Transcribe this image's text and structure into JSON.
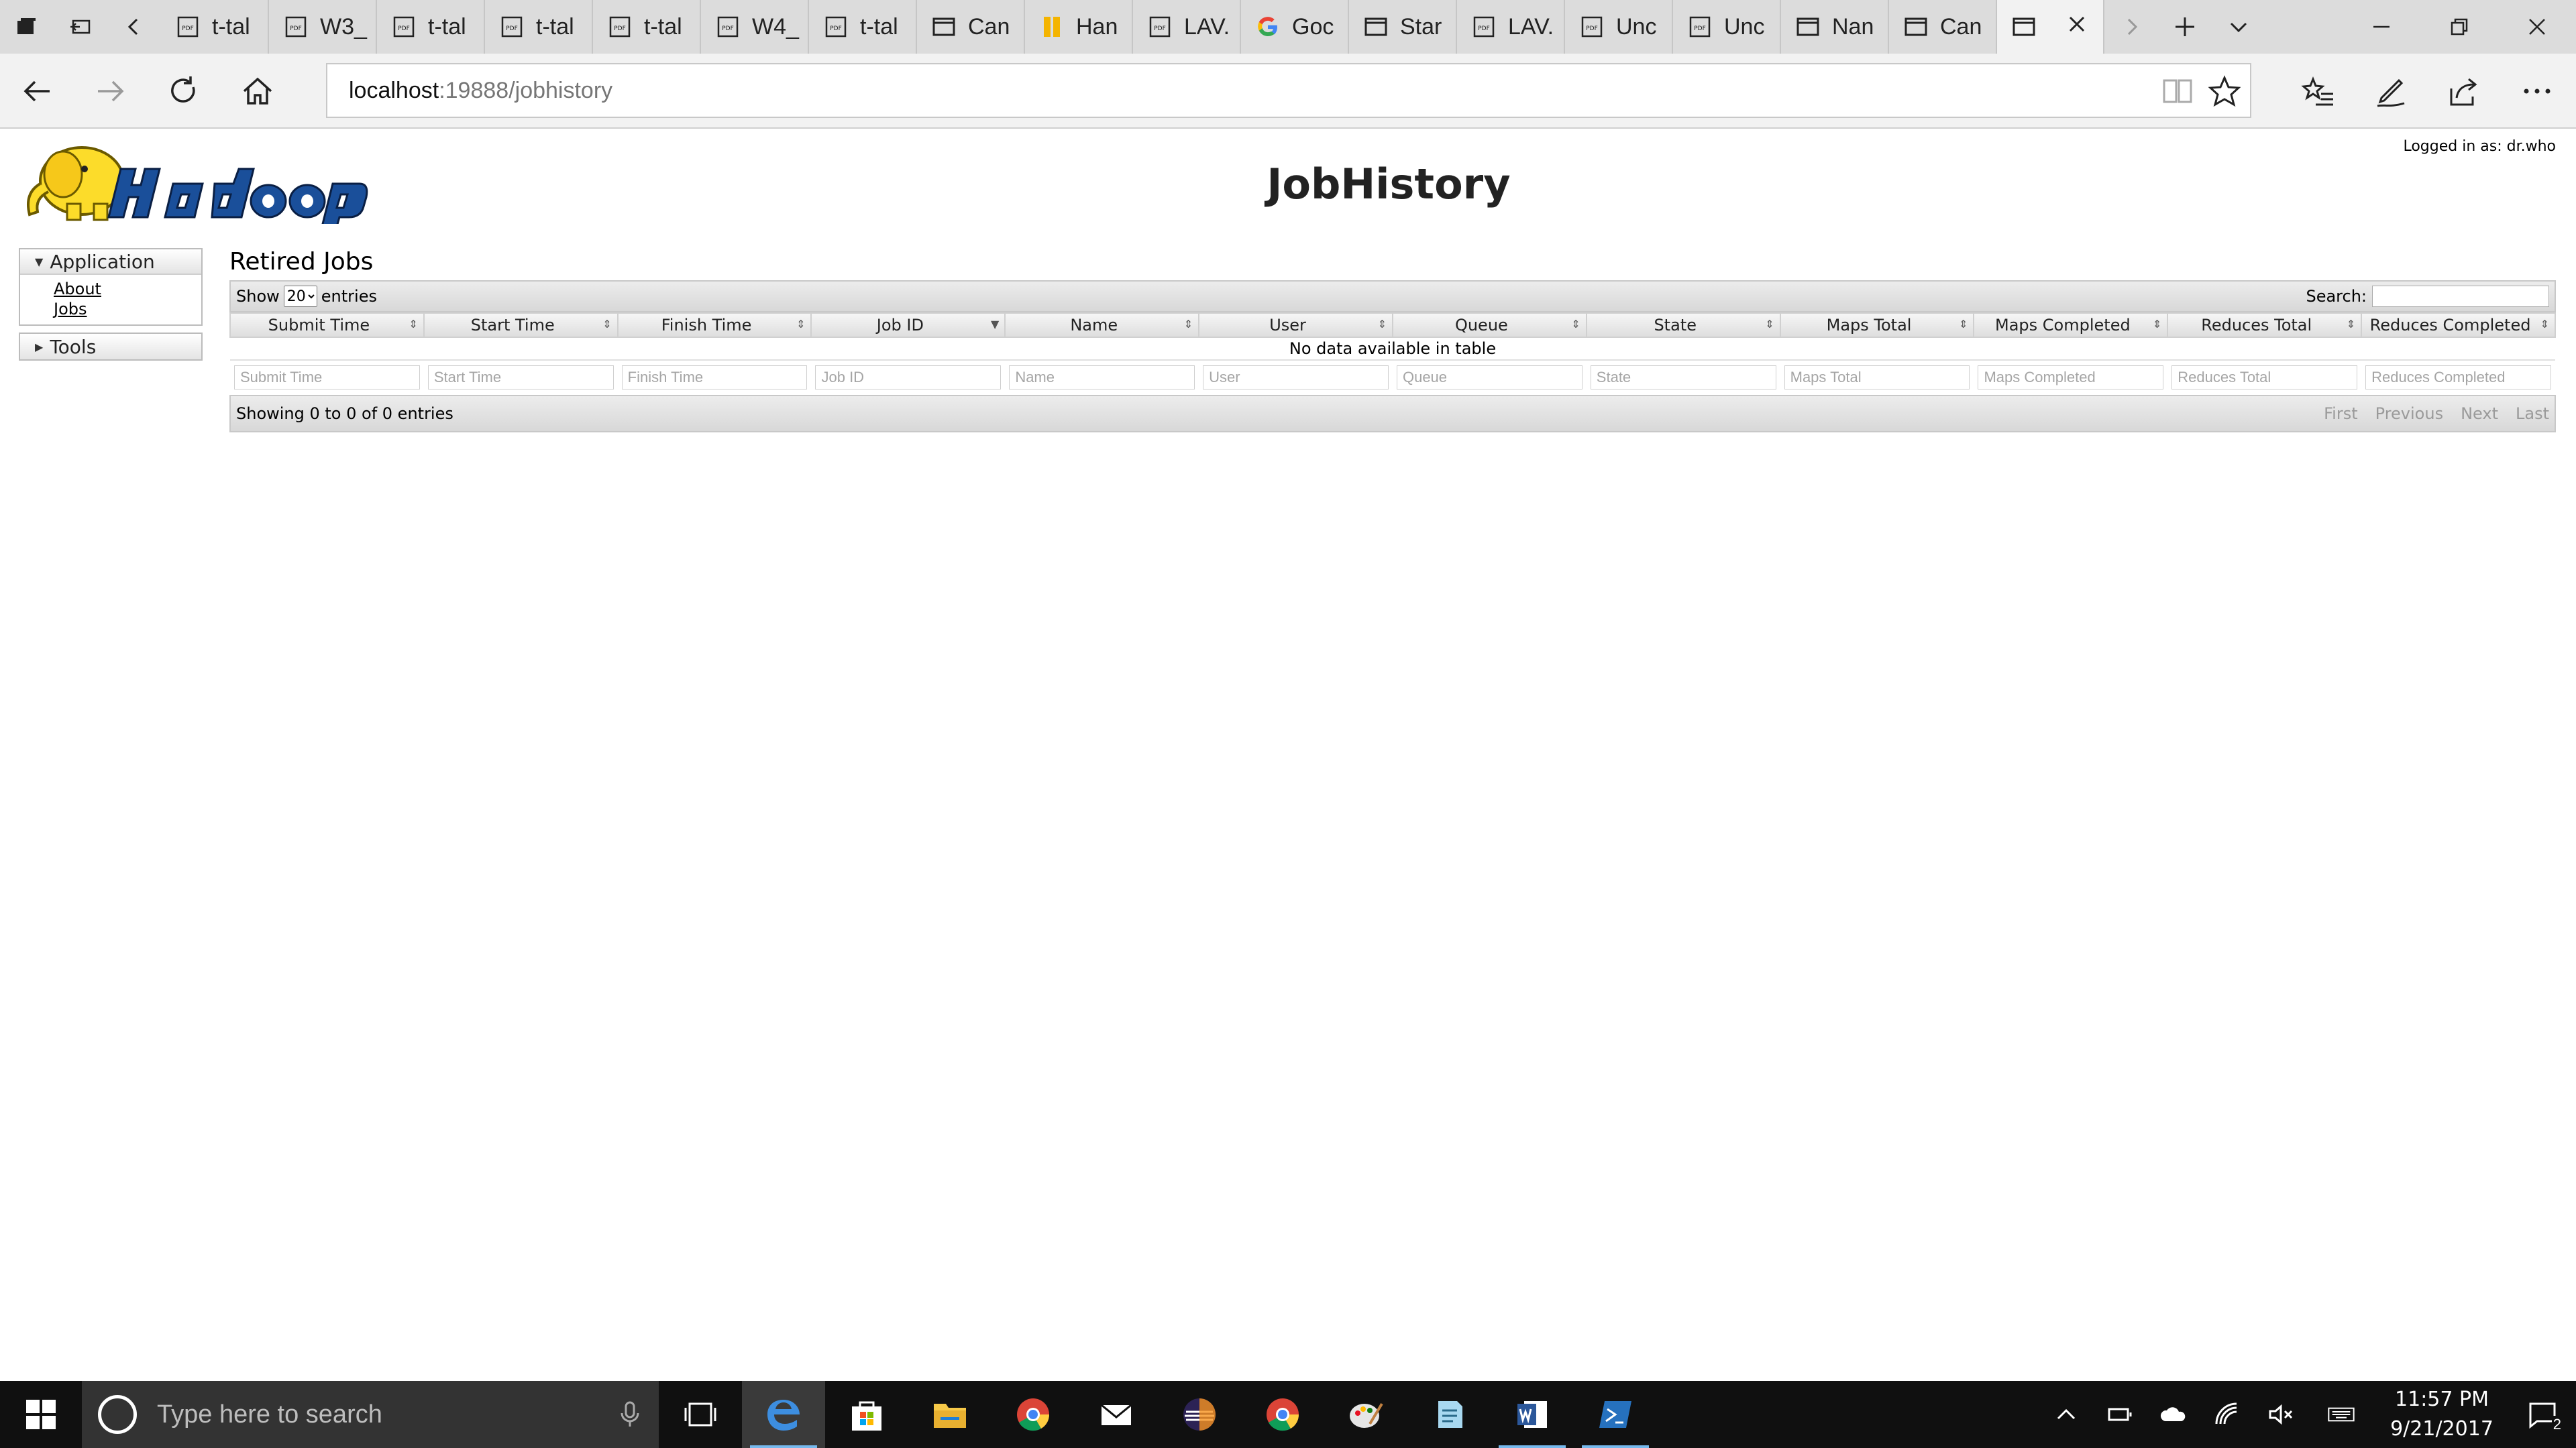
{
  "browser": {
    "tabs": [
      {
        "label": "t-tal",
        "icon": "pdf-icon"
      },
      {
        "label": "W3_",
        "icon": "pdf-icon"
      },
      {
        "label": "t-tal",
        "icon": "pdf-icon"
      },
      {
        "label": "t-tal",
        "icon": "pdf-icon"
      },
      {
        "label": "t-tal",
        "icon": "pdf-icon"
      },
      {
        "label": "W4_",
        "icon": "pdf-icon"
      },
      {
        "label": "t-tal",
        "icon": "pdf-icon"
      },
      {
        "label": "Can",
        "icon": "page-icon"
      },
      {
        "label": "Han",
        "icon": "bookmark-icon"
      },
      {
        "label": "LAV.",
        "icon": "pdf-icon"
      },
      {
        "label": "Goc",
        "icon": "google-icon"
      },
      {
        "label": "Star",
        "icon": "page-icon"
      },
      {
        "label": "LAV.",
        "icon": "pdf-icon"
      },
      {
        "label": "Unc",
        "icon": "pdf-icon"
      },
      {
        "label": "Unc",
        "icon": "pdf-icon"
      },
      {
        "label": "Nan",
        "icon": "page-icon"
      },
      {
        "label": "Can",
        "icon": "page-icon"
      }
    ],
    "url_host": "localhost",
    "url_rest": ":19888/jobhistory"
  },
  "page": {
    "title": "JobHistory",
    "logged_in": "Logged in as: dr.who",
    "nav": {
      "application": "Application",
      "links": [
        "About",
        "Jobs"
      ],
      "tools": "Tools"
    },
    "section_title": "Retired Jobs",
    "show_label": "Show",
    "entries_value": "20",
    "entries_label": "entries",
    "search_label": "Search:",
    "columns": [
      "Submit Time",
      "Start Time",
      "Finish Time",
      "Job ID",
      "Name",
      "User",
      "Queue",
      "State",
      "Maps Total",
      "Maps Completed",
      "Reduces Total",
      "Reduces Completed"
    ],
    "empty_message": "No data available in table",
    "info": "Showing 0 to 0 of 0 entries",
    "pagination": [
      "First",
      "Previous",
      "Next",
      "Last"
    ]
  },
  "taskbar": {
    "search_placeholder": "Type here to search",
    "time": "11:57 PM",
    "date": "9/21/2017",
    "notifications": "2"
  },
  "colors": {
    "taskbar": "#101010",
    "accent": "#76b9ed",
    "edge_blue": "#0078d7"
  }
}
